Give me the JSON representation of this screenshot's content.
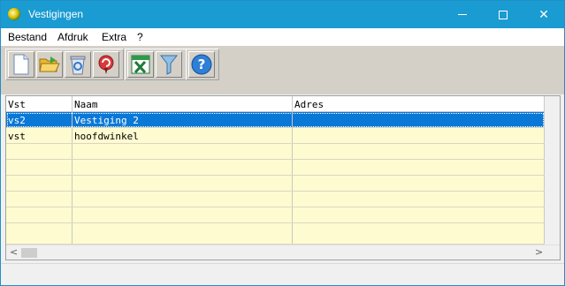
{
  "window": {
    "title": "Vestigingen",
    "controls": {
      "minimize": "minimize",
      "maximize": "maximize",
      "close": "✕"
    }
  },
  "menu": [
    "Bestand",
    "Afdruk",
    "Extra",
    "?"
  ],
  "toolbar": {
    "buttons": [
      "new-document-icon",
      "open-folder-icon",
      "recycle-bin-icon",
      "undo-icon",
      "excel-export-icon",
      "filter-icon",
      "help-icon"
    ]
  },
  "grid": {
    "columns": [
      "Vst",
      "Naam",
      "Adres"
    ],
    "rows": [
      [
        "vs2",
        "Vestiging 2",
        ""
      ],
      [
        "vst",
        "hoofdwinkel",
        ""
      ]
    ],
    "selected_row": 0
  },
  "colors": {
    "title_bar": "#1a9bd1",
    "grid_background": "#fffbd0",
    "selection": "#0a78d7"
  }
}
